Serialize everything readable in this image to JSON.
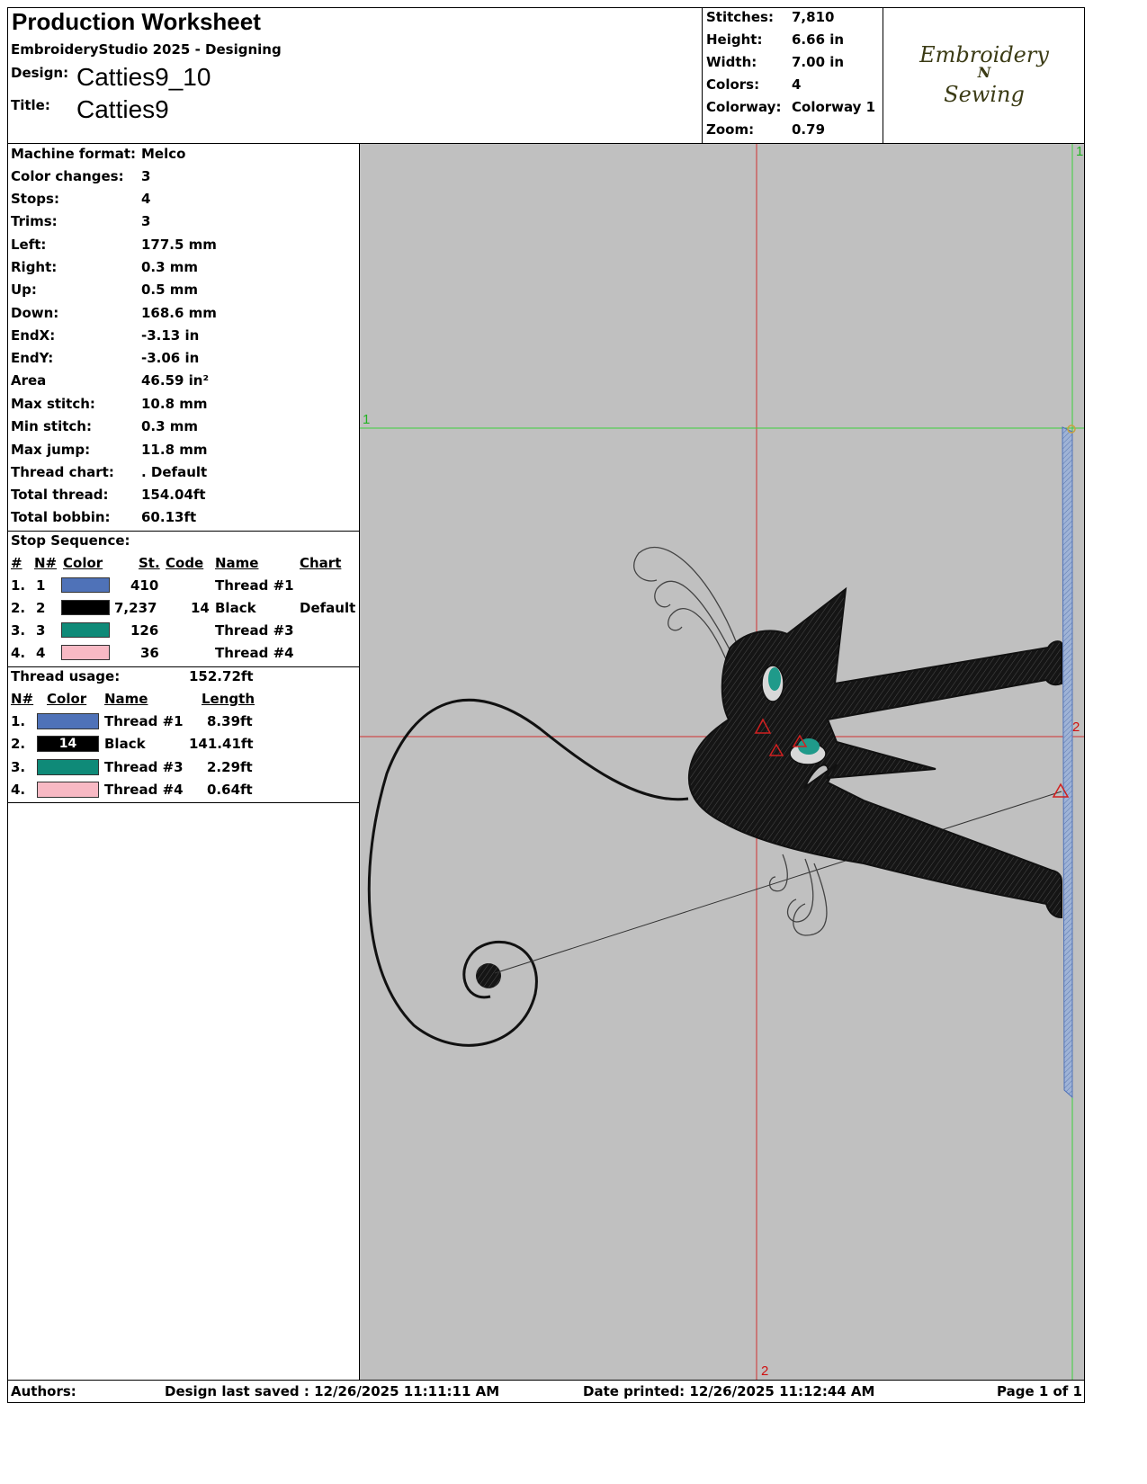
{
  "header": {
    "title": "Production Worksheet",
    "subtitle": "EmbroideryStudio 2025 - Designing",
    "design_label": "Design:",
    "design_value": "Catties9_10",
    "title_label": "Title:",
    "title_value": "Catties9"
  },
  "stats": [
    {
      "label": "Stitches:",
      "value": "7,810"
    },
    {
      "label": "Height:",
      "value": "6.66 in"
    },
    {
      "label": "Width:",
      "value": "7.00 in"
    },
    {
      "label": "Colors:",
      "value": "4"
    },
    {
      "label": "Colorway:",
      "value": "Colorway 1"
    },
    {
      "label": "Zoom:",
      "value": "0.79"
    }
  ],
  "logo": {
    "line1": "Embroidery",
    "line2": "N",
    "line3": "Sewing"
  },
  "info": [
    {
      "label": "Machine format:",
      "value": "Melco"
    },
    {
      "label": "Color changes:",
      "value": "3"
    },
    {
      "label": "Stops:",
      "value": "4"
    },
    {
      "label": "Trims:",
      "value": "3"
    },
    {
      "label": "Left:",
      "value": "177.5 mm"
    },
    {
      "label": "Right:",
      "value": "0.3 mm"
    },
    {
      "label": "Up:",
      "value": "0.5 mm"
    },
    {
      "label": "Down:",
      "value": "168.6 mm"
    },
    {
      "label": "EndX:",
      "value": "-3.13 in"
    },
    {
      "label": "EndY:",
      "value": "-3.06 in"
    },
    {
      "label": "Area",
      "value": " 46.59 in²"
    },
    {
      "label": "Max stitch:",
      "value": "10.8 mm"
    },
    {
      "label": "Min stitch:",
      "value": "0.3 mm"
    },
    {
      "label": "Max jump:",
      "value": "11.8 mm"
    },
    {
      "label": "Thread chart:",
      "value": ". Default"
    },
    {
      "label": "Total thread:",
      "value": "154.04ft"
    },
    {
      "label": "Total bobbin:",
      "value": "60.13ft"
    }
  ],
  "stop_sequence": {
    "heading": "Stop Sequence:",
    "columns": {
      "num": "#",
      "n": "N#",
      "color": "Color",
      "st": "St.",
      "code": "Code",
      "name": "Name",
      "chart": "Chart"
    },
    "rows": [
      {
        "num": "1.",
        "n": "1",
        "color": "#4f72b8",
        "st": "410",
        "code": "",
        "name": "Thread #1",
        "chart": ""
      },
      {
        "num": "2.",
        "n": "2",
        "color": "#000000",
        "st": "7,237",
        "code": "14",
        "name": "Black",
        "chart": "Default"
      },
      {
        "num": "3.",
        "n": "3",
        "color": "#0f8a78",
        "st": "126",
        "code": "",
        "name": "Thread #3",
        "chart": ""
      },
      {
        "num": "4.",
        "n": "4",
        "color": "#f8b9c4",
        "st": "36",
        "code": "",
        "name": "Thread #4",
        "chart": ""
      }
    ]
  },
  "thread_usage": {
    "heading": "Thread usage:",
    "total": "152.72ft",
    "columns": {
      "n": "N#",
      "color": "Color",
      "name": "Name",
      "length": "Length"
    },
    "rows": [
      {
        "n": "1.",
        "color": "#4f72b8",
        "code": "",
        "name": "Thread #1",
        "length": "8.39ft"
      },
      {
        "n": "2.",
        "color": "#000000",
        "code": "14",
        "name": "Black",
        "length": "141.41ft"
      },
      {
        "n": "3.",
        "color": "#0f8a78",
        "code": "",
        "name": "Thread #3",
        "length": "2.29ft"
      },
      {
        "n": "4.",
        "color": "#f8b9c4",
        "code": "",
        "name": "Thread #4",
        "length": "0.64ft"
      }
    ]
  },
  "canvas": {
    "background": "#c0c0c0",
    "markers": {
      "green_top": "1",
      "green_left": "1",
      "red_right": "2",
      "red_bottom": "2"
    }
  },
  "footer": {
    "authors": "Authors:",
    "saved": "Design last saved : 12/26/2025 11:11:11 AM",
    "printed": "Date printed: 12/26/2025 11:12:44 AM",
    "page": "Page 1 of 1"
  }
}
